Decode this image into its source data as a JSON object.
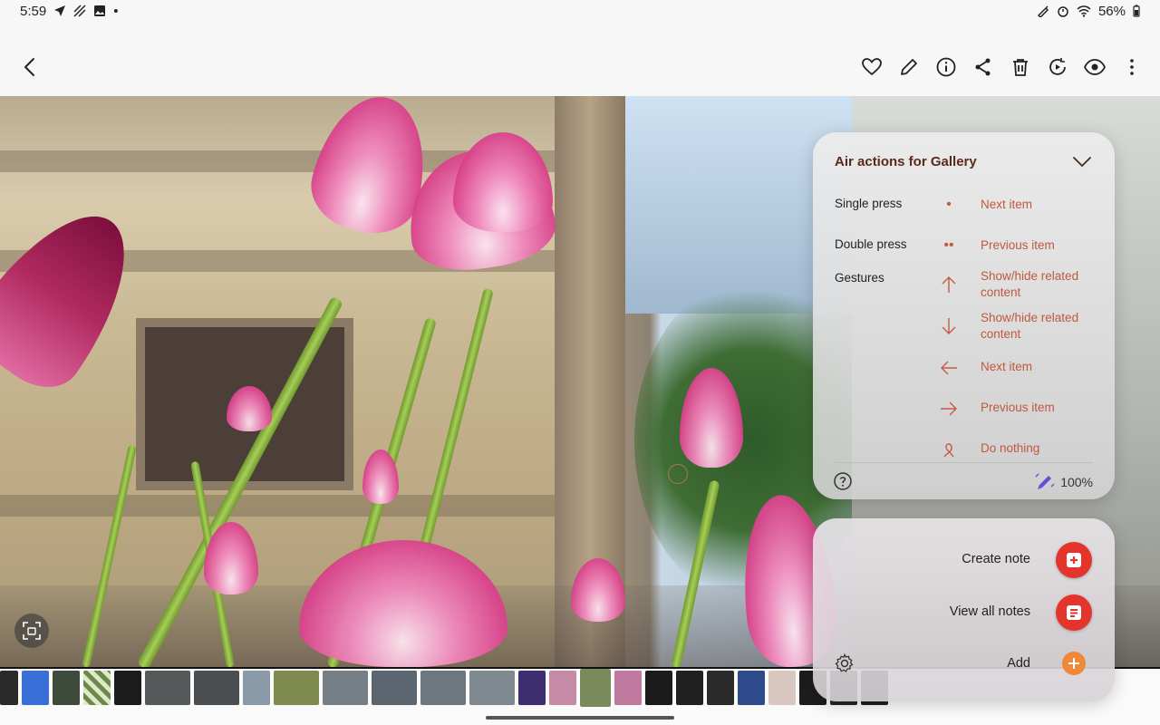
{
  "status_bar": {
    "time": "5:59",
    "dot": "•",
    "battery": "56%"
  },
  "toolbar": {
    "back": "back-icon",
    "actions": [
      "heart-icon",
      "edit-icon",
      "info-icon",
      "share-icon",
      "delete-icon",
      "remaster-icon",
      "view-icon",
      "more-icon"
    ]
  },
  "air_actions": {
    "title": "Air actions for Gallery",
    "rows": [
      {
        "label": "Single press",
        "glyph": "•",
        "action": "Next item"
      },
      {
        "label": "Double press",
        "glyph": "••",
        "action": "Previous item"
      },
      {
        "label": "Gestures",
        "glyph": "arrow-up-icon",
        "action": "Show/hide related content"
      },
      {
        "label": "",
        "glyph": "arrow-down-icon",
        "action": "Show/hide related content"
      },
      {
        "label": "",
        "glyph": "arrow-left-icon",
        "action": "Next item"
      },
      {
        "label": "",
        "glyph": "arrow-right-icon",
        "action": "Previous item"
      },
      {
        "label": "",
        "glyph": "swirl-icon",
        "action": "Do nothing"
      }
    ],
    "pen_battery": "100%"
  },
  "notes_panel": {
    "create_note": "Create note",
    "view_all_notes": "View all notes",
    "add": "Add"
  },
  "colors": {
    "accent": "#c0583f",
    "note_button": "#e3352b",
    "add_button": "#f0883a"
  }
}
